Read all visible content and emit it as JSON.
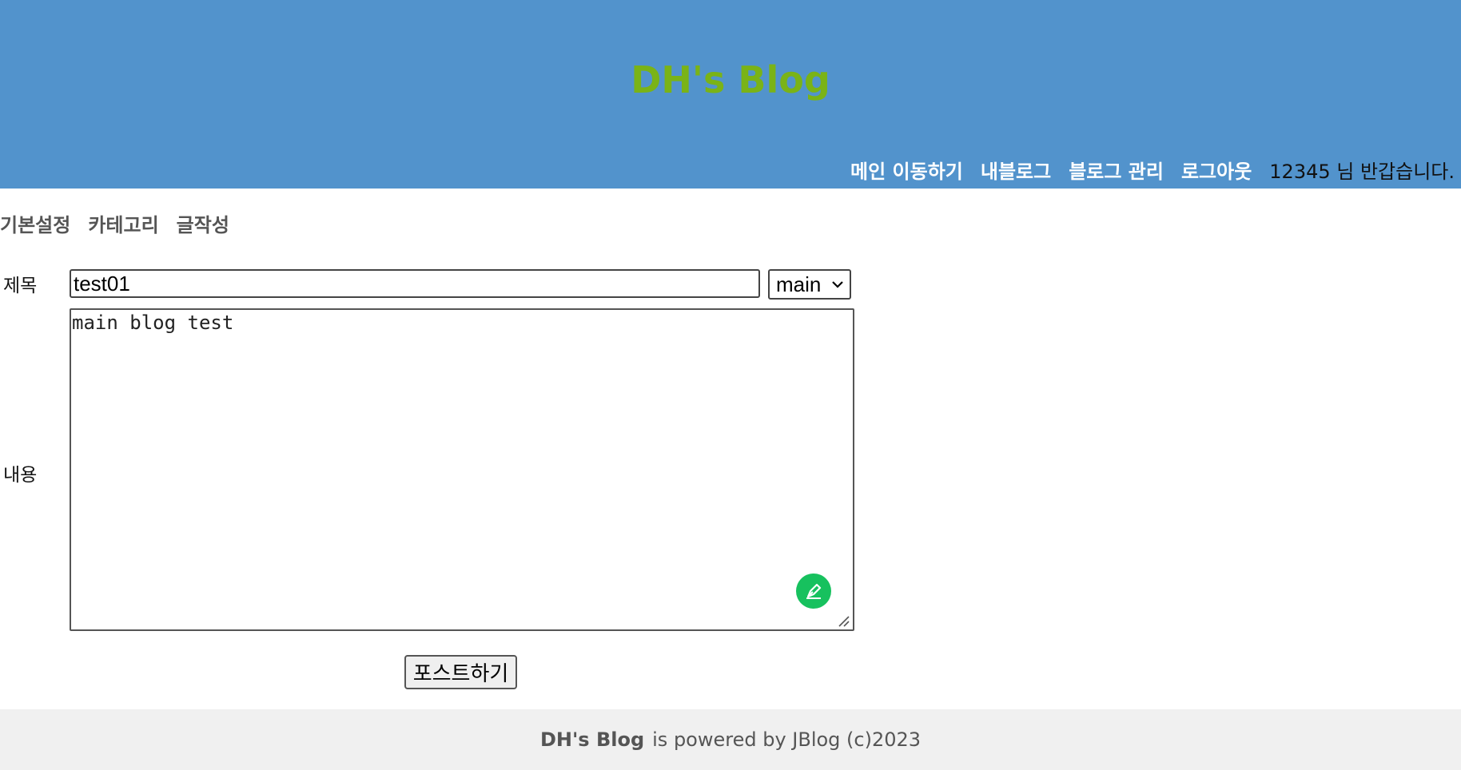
{
  "header": {
    "title": "DH's Blog",
    "nav": {
      "main": "메인 이동하기",
      "my_blog": "내블로그",
      "blog_admin": "블로그 관리",
      "logout": "로그아웃",
      "greeting": "12345 님 반갑습니다."
    }
  },
  "admin_menu": {
    "basic_settings": "기본설정",
    "category": "카테고리",
    "write": "글작성"
  },
  "form": {
    "title_label": "제목",
    "title_value": "test01",
    "category_selected": "main",
    "content_label": "내용",
    "content_value": "main blog test",
    "submit_label": "포스트하기"
  },
  "footer": {
    "brand": "DH's Blog",
    "text": "is powered by JBlog (c)2023"
  },
  "colors": {
    "header_bg": "#5293cc",
    "title_color": "#7ab317",
    "pen_button": "#17c15e",
    "footer_bg": "#f0f0f0"
  },
  "icons": {
    "pen_button": "pen-icon",
    "select_arrow": "chevron-down-icon",
    "resize": "resize-handle-icon"
  }
}
